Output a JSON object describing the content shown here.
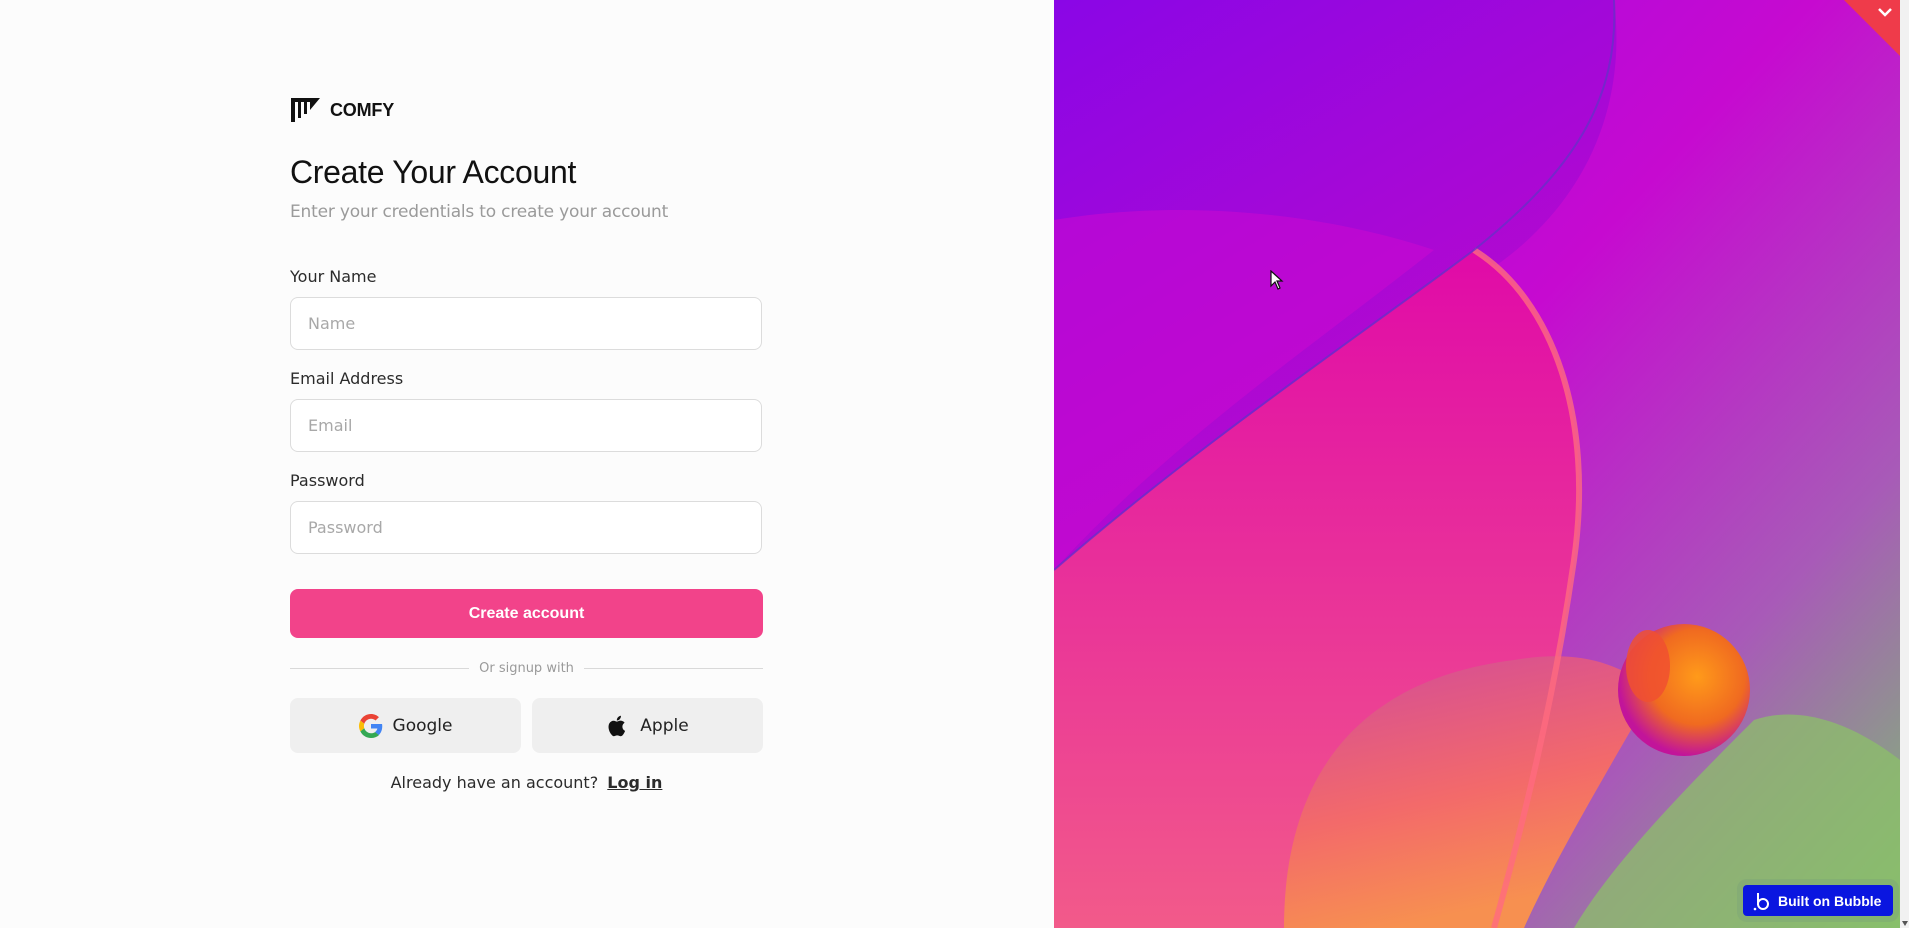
{
  "brand": {
    "name": "COMFY",
    "logo_icon": "comfy-logo-icon"
  },
  "header": {
    "title": "Create Your Account",
    "subtitle": "Enter your credentials to create your account"
  },
  "form": {
    "name": {
      "label": "Your Name",
      "placeholder": "Name",
      "value": ""
    },
    "email": {
      "label": "Email Address",
      "placeholder": "Email",
      "value": ""
    },
    "password": {
      "label": "Password",
      "placeholder": "Password",
      "value": ""
    },
    "submit_label": "Create account"
  },
  "social": {
    "divider_text": "Or signup with",
    "google_label": "Google",
    "apple_label": "Apple",
    "google_icon": "google-icon",
    "apple_icon": "apple-icon"
  },
  "footer": {
    "prompt": "Already have an account?",
    "login_label": "Log in"
  },
  "badge": {
    "label": "Built on Bubble",
    "icon": "bubble-icon"
  },
  "colors": {
    "accent": "#f2438a",
    "badge_bg": "#0a16e0",
    "corner_badge": "#ef3b4a"
  }
}
